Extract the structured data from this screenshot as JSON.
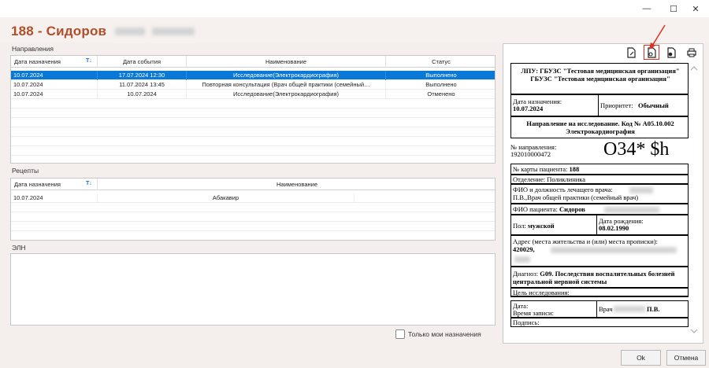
{
  "window": {
    "minimize": "—",
    "maximize": "☐",
    "close": "✕"
  },
  "header": {
    "title": "188 - Сидоров"
  },
  "directions": {
    "label": "Направления",
    "columns": [
      "Дата назначения",
      "Дата события",
      "Наименование",
      "Статус"
    ],
    "rows": [
      {
        "date": "10.07.2024",
        "event": "17.07.2024 12:30",
        "name": "Исследование(Электрокардиография)",
        "status": "Выполнено"
      },
      {
        "date": "10.07.2024",
        "event": "11.07.2024 13:45",
        "name": "Повторная консультация (Врач общей практики (семейный…",
        "status": "Выполнено"
      },
      {
        "date": "10.07.2024",
        "event": "10.07.2024",
        "name": "Исследование(Электрокардиография)",
        "status": "Отменено"
      }
    ]
  },
  "recipes": {
    "label": "Рецепты",
    "columns": [
      "Дата назначения",
      "Наименование"
    ],
    "rows": [
      {
        "date": "10.07.2024",
        "name": "Абакавир"
      }
    ]
  },
  "eln": {
    "label": "ЭЛН"
  },
  "only_mine": {
    "label": "Только мои назначения"
  },
  "buttons": {
    "ok": "Ok",
    "cancel": "Отмена"
  },
  "document": {
    "org": "ЛПУ: ГБУЗС \"Тестовая медицинская организация\" ГБУЗС \"Тестовая медицинская организация\"",
    "date_label": "Дата назначения:",
    "date_value": "10.07.2024",
    "priority_label": "Приоритет:",
    "priority_value": "Обычный",
    "title": "Направление на исследование. Код № А05.10.002 Электрокардиография",
    "num_label": "№ направления:",
    "num_value": "192010000472",
    "barcode_text": "O34* $h",
    "card_label": "№ карты пациента:",
    "card_value": "188",
    "dept": "Отделение: Поликлиника",
    "doctor_label": "ФИО и должность лечащего врача:",
    "doctor_value": "П.В.,Врач общей практики (семейный врач)",
    "patient_label": "ФИО пациента:",
    "patient_value": "Сидоров",
    "sex_label": "Пол:",
    "sex_value": "мужской",
    "birth_label": "Дата рождения:",
    "birth_value": "08.02.1990",
    "address_label": "Адрес (места жительства и (или) места прописки):",
    "address_value": "420029,",
    "diag_label": "Диагноз:",
    "diag_value": "G09. Последствия воспалительных болезней центральной нервной системы",
    "goal": "Цель исследования:",
    "datetime_label": "Дата:",
    "time_label": "Время записи:",
    "doc_label": "Врач",
    "doc_value": "П.В.",
    "sign": "Подпись:"
  }
}
